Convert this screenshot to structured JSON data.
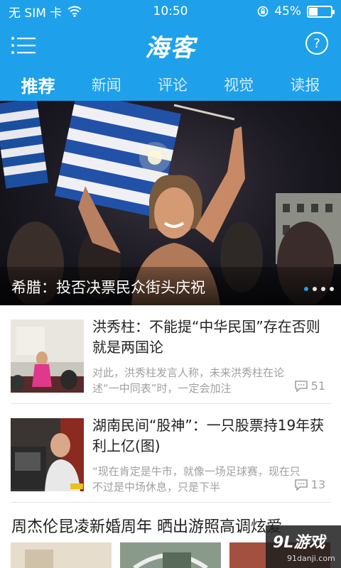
{
  "status_bar": {
    "carrier": "无 SIM 卡",
    "time": "10:50",
    "battery_percent": "45%",
    "battery_level": 0.45
  },
  "header": {
    "logo": "海客",
    "menu_icon": "hamburger-icon",
    "help_icon": "question-mark-icon",
    "help_glyph": "?"
  },
  "tabs": [
    {
      "label": "推荐",
      "active": true
    },
    {
      "label": "新闻",
      "active": false
    },
    {
      "label": "评论",
      "active": false
    },
    {
      "label": "视觉",
      "active": false
    },
    {
      "label": "读报",
      "active": false
    }
  ],
  "hero": {
    "caption": "希腊：投否决票民众街头庆祝"
  },
  "news": [
    {
      "title": "洪秀柱：不能提“中华民国”存在否则就是两国论",
      "summary": "对此，洪秀柱发言人称，未来洪秀柱在论述“一中同表”时，一定会加注",
      "comments": "51"
    },
    {
      "title": "湖南民间“股神”：一只股票持19年获利上亿(图)",
      "summary": "“现在肯定是牛市，就像一场足球赛，现在只不过是中场休息，只是下半",
      "comments": "13"
    }
  ],
  "gallery": {
    "title": "周杰伦昆凌新婚周年 晒出游照高调炫爱"
  },
  "watermark": {
    "main": "9L游戏",
    "sub": "91danji.com"
  }
}
